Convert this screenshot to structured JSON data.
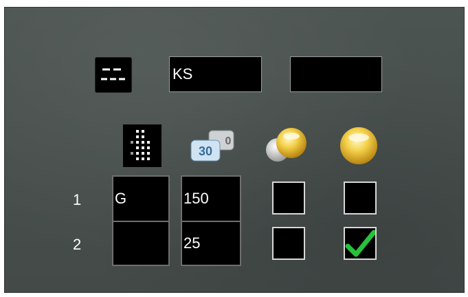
{
  "header": {
    "icon": "dashed-lines-icon",
    "field1_value": "KS",
    "field2_value": ""
  },
  "columns": {
    "icons": [
      "grid-icon",
      "counter-icon",
      "dual-light-icon",
      "light-icon"
    ]
  },
  "rows": [
    {
      "num": "1",
      "col1": "G",
      "col2": "150",
      "check1": false,
      "check2": false
    },
    {
      "num": "2",
      "col1": "",
      "col2": "25",
      "check1": false,
      "check2": true
    }
  ],
  "counter_icon": {
    "front": "30",
    "back": "0"
  },
  "colors": {
    "check": "#27c23a",
    "light": "#f2c534"
  }
}
